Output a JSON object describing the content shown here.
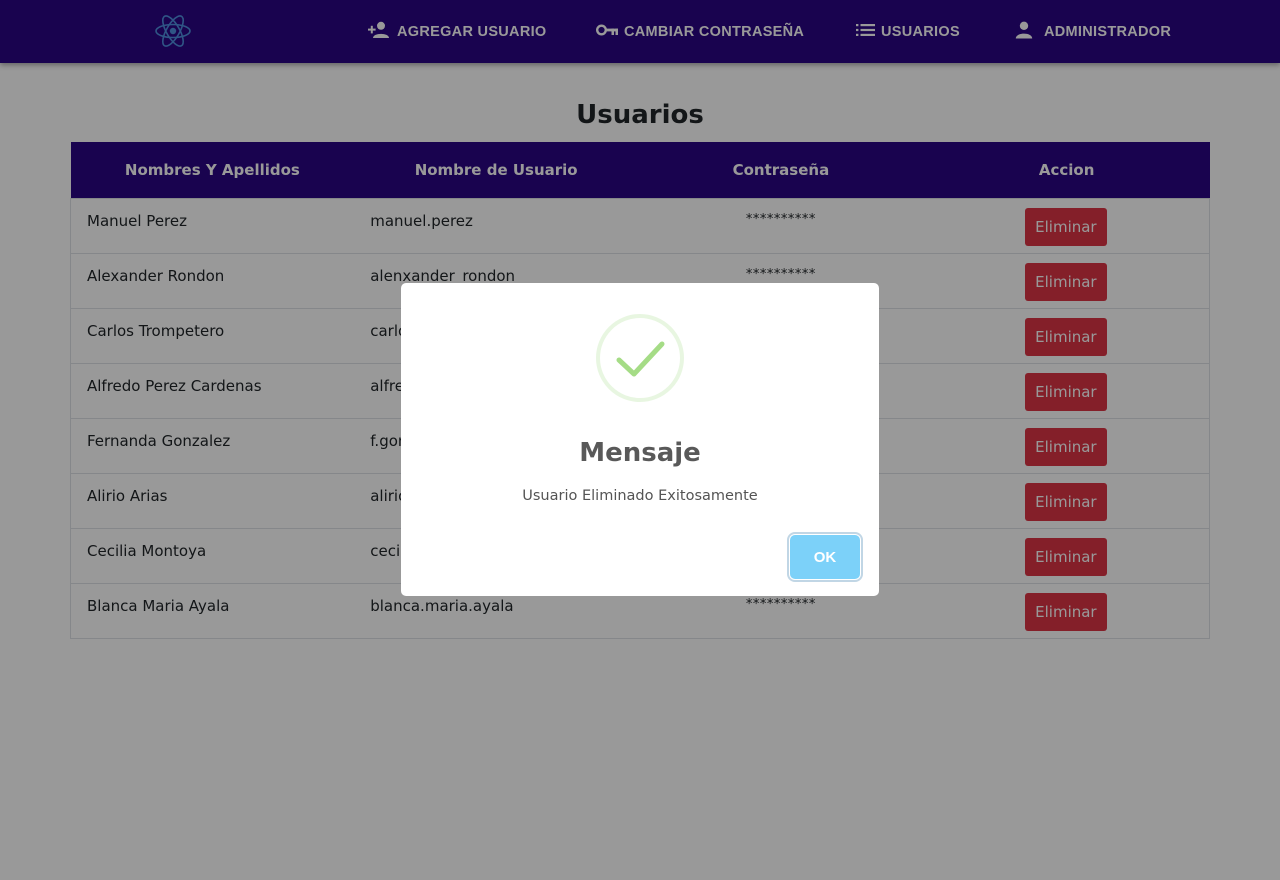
{
  "navbar": {
    "logo": "react-atom-logo",
    "items": [
      {
        "label": "AGREGAR USUARIO",
        "icon": "person-add-icon"
      },
      {
        "label": "CAMBIAR CONTRASEÑA",
        "icon": "key-icon"
      },
      {
        "label": "USUARIOS",
        "icon": "list-icon"
      },
      {
        "label": "ADMINISTRADOR",
        "icon": "person-icon"
      }
    ]
  },
  "page": {
    "title": "Usuarios"
  },
  "table": {
    "headers": [
      "Nombres Y Apellidos",
      "Nombre de Usuario",
      "Contraseña",
      "Accion"
    ],
    "rows": [
      {
        "name": "Manuel Perez",
        "username": "manuel.perez",
        "password": "**********",
        "action": "Eliminar"
      },
      {
        "name": "Alexander Rondon",
        "username": "alenxander_rondon",
        "password": "**********",
        "action": "Eliminar"
      },
      {
        "name": "Carlos Trompetero",
        "username": "carlo",
        "password": "**********",
        "action": "Eliminar"
      },
      {
        "name": "Alfredo Perez Cardenas",
        "username": "alfre",
        "password": "**********",
        "action": "Eliminar"
      },
      {
        "name": "Fernanda Gonzalez",
        "username": "f.gon",
        "password": "**********",
        "action": "Eliminar"
      },
      {
        "name": "Alirio Arias",
        "username": "alirio",
        "password": "**********",
        "action": "Eliminar"
      },
      {
        "name": "Cecilia Montoya",
        "username": "cecil",
        "password": "**********",
        "action": "Eliminar"
      },
      {
        "name": "Blanca Maria Ayala",
        "username": "blanca.maria.ayala",
        "password": "**********",
        "action": "Eliminar"
      }
    ]
  },
  "modal": {
    "icon": "success-check-icon",
    "title": "Mensaje",
    "text": "Usuario Eliminado Exitosamente",
    "ok_label": "OK"
  },
  "colors": {
    "navbar": "#2a0684",
    "delete_button": "#dc3545",
    "ok_button": "#7cd1f9",
    "success": "#a5dc86",
    "logo": "#61dafb"
  }
}
